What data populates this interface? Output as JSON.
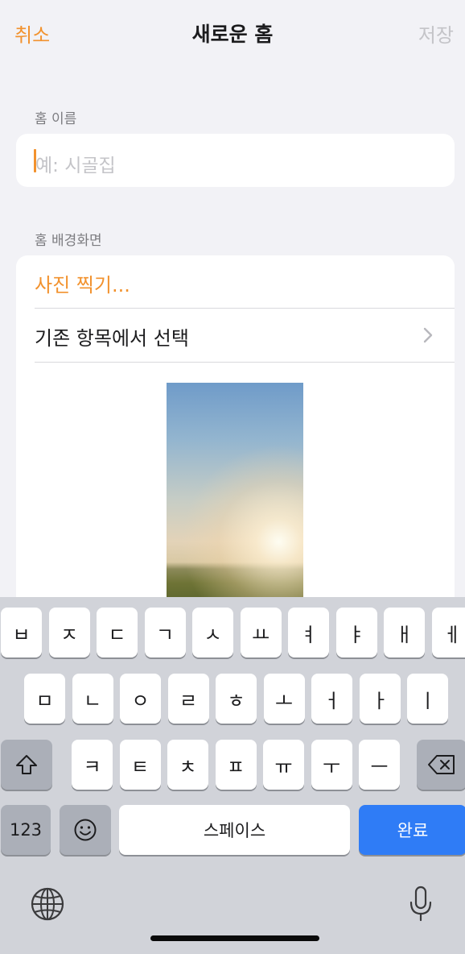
{
  "colors": {
    "accent": "#f2922e",
    "disabled": "#c4c4c8",
    "done_key": "#2f7cf6"
  },
  "nav": {
    "cancel": "취소",
    "title": "새로운 홈",
    "save": "저장"
  },
  "home_name": {
    "section_label": "홈 이름",
    "placeholder": "예: 시골집",
    "value": ""
  },
  "wallpaper": {
    "section_label": "홈 배경화면",
    "take_photo": "사진 찍기...",
    "choose_existing": "기존 항목에서 선택"
  },
  "keyboard": {
    "row1": [
      "ㅂ",
      "ㅈ",
      "ㄷ",
      "ㄱ",
      "ㅅ",
      "ㅛ",
      "ㅕ",
      "ㅑ",
      "ㅐ",
      "ㅔ"
    ],
    "row2": [
      "ㅁ",
      "ㄴ",
      "ㅇ",
      "ㄹ",
      "ㅎ",
      "ㅗ",
      "ㅓ",
      "ㅏ",
      "ㅣ"
    ],
    "row3": [
      "ㅋ",
      "ㅌ",
      "ㅊ",
      "ㅍ",
      "ㅠ",
      "ㅜ",
      "ㅡ"
    ],
    "numbers_key": "123",
    "space_key": "스페이스",
    "done_key": "완료",
    "icons": {
      "shift": "shift-icon",
      "delete": "delete-icon",
      "emoji": "emoji-icon",
      "globe": "globe-icon",
      "mic": "microphone-icon"
    }
  }
}
